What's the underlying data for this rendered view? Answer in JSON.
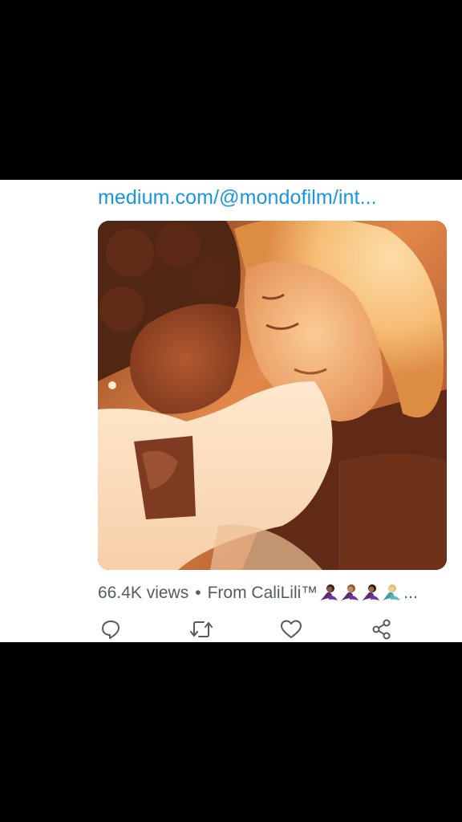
{
  "tweet": {
    "link_text": "medium.com/@mondofilm/int...",
    "views": "66.4K views",
    "separator": "•",
    "source_name": "From CaliLili™",
    "ellipsis": "...",
    "source_emoji_icons": [
      "mermaid-icon",
      "mermaid-icon",
      "mermaid-icon",
      "mermaid-icon"
    ]
  },
  "actions": [
    {
      "icon": "reply-icon"
    },
    {
      "icon": "retweet-icon"
    },
    {
      "icon": "like-icon"
    },
    {
      "icon": "share-icon"
    }
  ],
  "colors": {
    "link": "#1b95e0",
    "meta_text": "#545b61",
    "icon": "#545b61",
    "background": "#ffffff",
    "letterbox": "#000000"
  }
}
